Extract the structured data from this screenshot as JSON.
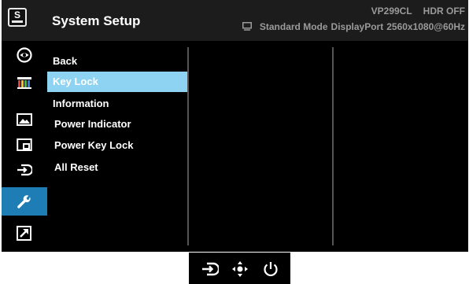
{
  "header": {
    "logo_letter": "S",
    "title": "System Setup",
    "model": "VP299CL",
    "hdr": "HDR OFF",
    "mode": "Standard Mode",
    "input": "DisplayPort",
    "resolution": "2560x1080@60Hz"
  },
  "sidebar": {
    "items": [
      {
        "icon": "splendid-eye-icon"
      },
      {
        "icon": "color-bars-icon"
      },
      {
        "icon": "image-icon"
      },
      {
        "icon": "pip-icon"
      },
      {
        "icon": "input-select-icon"
      },
      {
        "icon": "wrench-icon",
        "active": true
      },
      {
        "icon": "shortcut-arrow-icon"
      }
    ]
  },
  "menu": {
    "items": [
      {
        "label": "Back"
      },
      {
        "label": "Key Lock",
        "selected": true
      },
      {
        "label": "Information"
      },
      {
        "label": "Power Indicator"
      },
      {
        "label": "Power Key Lock"
      },
      {
        "label": "All Reset"
      }
    ]
  },
  "colors": {
    "active_sidebar": "#1e7db4",
    "selected_item": "#8fd3f2",
    "header_text": "#9a9a9a"
  },
  "buttons": [
    {
      "icon": "input-select-icon"
    },
    {
      "icon": "joystick-icon"
    },
    {
      "icon": "power-icon"
    }
  ]
}
